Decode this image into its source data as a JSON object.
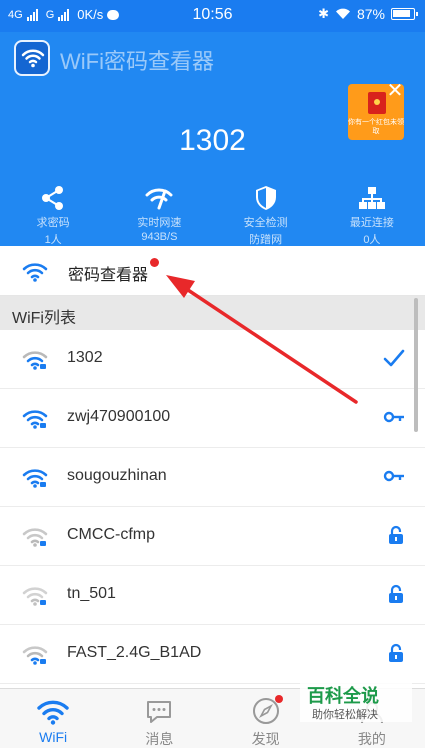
{
  "status_bar": {
    "network1": "4G",
    "network2": "G",
    "speed": "0K/s",
    "time": "10:56",
    "battery": "87%"
  },
  "header": {
    "app_title": "WiFi密码查看器",
    "connected_name": "1302",
    "ad_text": "你有一个红包未领取"
  },
  "stats": [
    {
      "icon": "share-icon",
      "label": "求密码",
      "value": "1人"
    },
    {
      "icon": "speed-icon",
      "label": "实时网速",
      "value": "943B/S"
    },
    {
      "icon": "shield-icon",
      "label": "安全检测",
      "value": "防蹭网"
    },
    {
      "icon": "network-icon",
      "label": "最近连接",
      "value": "0人"
    }
  ],
  "current": {
    "label": "密码查看器"
  },
  "section_title": "WiFi列表",
  "networks": [
    {
      "ssid": "1302",
      "status": "connected",
      "status_icon": "check-icon"
    },
    {
      "ssid": "zwj470900100",
      "status": "key",
      "status_icon": "key-icon"
    },
    {
      "ssid": "sougouzhinan",
      "status": "key",
      "status_icon": "key-icon"
    },
    {
      "ssid": "CMCC-cfmp",
      "status": "locked",
      "status_icon": "lock-icon"
    },
    {
      "ssid": "tn_501",
      "status": "locked",
      "status_icon": "lock-icon"
    },
    {
      "ssid": "FAST_2.4G_B1AD",
      "status": "locked",
      "status_icon": "lock-icon"
    }
  ],
  "nav": [
    {
      "label": "WiFi",
      "icon": "wifi-icon",
      "active": true
    },
    {
      "label": "消息",
      "icon": "message-icon",
      "active": false
    },
    {
      "label": "发现",
      "icon": "compass-icon",
      "active": false
    },
    {
      "label": "我的",
      "icon": "profile-icon",
      "active": false
    }
  ],
  "watermark": {
    "title": "百科全说",
    "subtitle": "助你轻松解决"
  },
  "colors": {
    "primary": "#1a7cf0",
    "header": "#2188f2",
    "accent_red": "#e8282a",
    "wifi_active": "#1a7cf0",
    "wifi_weak": "#b9b9b9"
  }
}
